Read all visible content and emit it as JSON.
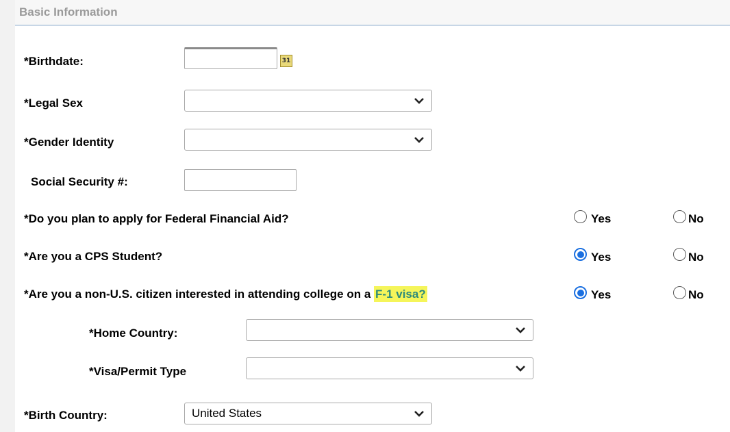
{
  "section": {
    "title": "Basic Information"
  },
  "fields": {
    "birthdate": {
      "label": "*Birthdate:",
      "value": "",
      "calendar_icon_text": "31"
    },
    "legal_sex": {
      "label": "*Legal Sex",
      "selected": ""
    },
    "gender_identity": {
      "label": "*Gender Identity",
      "selected": ""
    },
    "ssn": {
      "label": "Social Security #:",
      "value": ""
    },
    "home_country": {
      "label": "*Home Country:",
      "selected": ""
    },
    "visa_type": {
      "label": "*Visa/Permit Type",
      "selected": ""
    },
    "birth_country": {
      "label": "*Birth Country:",
      "selected": "United States"
    }
  },
  "questions": {
    "financial_aid": {
      "label": "*Do you plan to apply for Federal Financial Aid?",
      "yes_label": "Yes",
      "no_label": "No",
      "selected": "none"
    },
    "cps_student": {
      "label": "*Are you a CPS Student?",
      "yes_label": "Yes",
      "no_label": "No",
      "selected": "yes"
    },
    "f1_visa": {
      "label_prefix": "*Are you a non-U.S. citizen interested in attending college on a ",
      "label_highlight": "F-1 visa?",
      "yes_label": "Yes",
      "no_label": "No",
      "selected": "yes"
    }
  },
  "colors": {
    "radio_checked": "#1a6fe0",
    "highlight_bg": "#f5f55a",
    "highlight_text": "#2c8a7b",
    "section_title": "#9a9a9a"
  },
  "icons": {
    "calendar": "calendar-icon",
    "dropdown": "chevron-down-icon"
  }
}
